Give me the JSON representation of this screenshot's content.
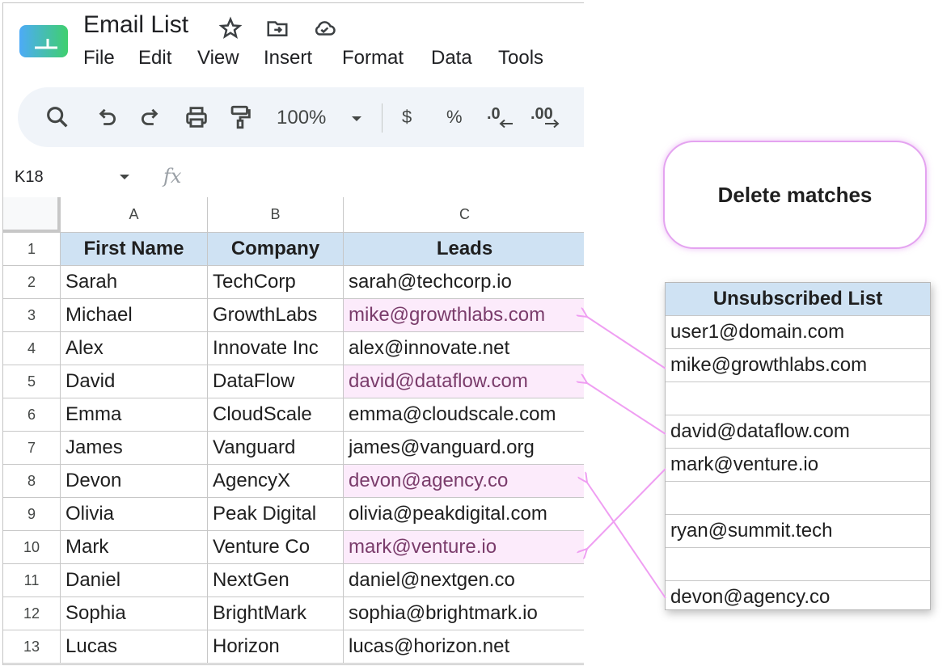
{
  "app": {
    "title": "Email List",
    "menu": [
      "File",
      "Edit",
      "View",
      "Insert",
      "Format",
      "Data",
      "Tools"
    ],
    "toolbar": {
      "zoom": "100%",
      "currency_symbol": "$",
      "percent_symbol": "%",
      "decrease_decimal": ".0",
      "increase_decimal": ".00"
    },
    "namebox": "K18",
    "fx_label": "fx"
  },
  "grid": {
    "columns": [
      "A",
      "B",
      "C"
    ],
    "row_numbers": [
      "1",
      "2",
      "3",
      "4",
      "5",
      "6",
      "7",
      "8",
      "9",
      "10",
      "11",
      "12",
      "13"
    ],
    "headers": [
      "First Name",
      "Company",
      "Leads"
    ],
    "rows": [
      {
        "first": "Sarah",
        "company": "TechCorp",
        "lead": "sarah@techcorp.io",
        "match": false
      },
      {
        "first": "Michael",
        "company": "GrowthLabs",
        "lead": "mike@growthlabs.com",
        "match": true
      },
      {
        "first": "Alex",
        "company": "Innovate Inc",
        "lead": "alex@innovate.net",
        "match": false
      },
      {
        "first": "David",
        "company": "DataFlow",
        "lead": "david@dataflow.com",
        "match": true
      },
      {
        "first": "Emma",
        "company": "CloudScale",
        "lead": "emma@cloudscale.com",
        "match": false
      },
      {
        "first": "James",
        "company": "Vanguard",
        "lead": "james@vanguard.org",
        "match": false
      },
      {
        "first": "Devon",
        "company": "AgencyX",
        "lead": "devon@agency.co",
        "match": true
      },
      {
        "first": "Olivia",
        "company": "Peak Digital",
        "lead": "olivia@peakdigital.com",
        "match": false
      },
      {
        "first": "Mark",
        "company": "Venture Co",
        "lead": "mark@venture.io",
        "match": true
      },
      {
        "first": "Daniel",
        "company": "NextGen",
        "lead": "daniel@nextgen.co",
        "match": false
      },
      {
        "first": "Sophia",
        "company": "BrightMark",
        "lead": "sophia@brightmark.io",
        "match": false
      },
      {
        "first": "Lucas",
        "company": "Horizon",
        "lead": "lucas@horizon.net",
        "match": false
      }
    ]
  },
  "unsubscribed": {
    "title": "Unsubscribed List",
    "items": [
      "user1@domain.com",
      "mike@growthlabs.com",
      "",
      "david@dataflow.com",
      "mark@venture.io",
      "",
      "ryan@summit.tech",
      "",
      "devon@agency.co"
    ]
  },
  "action_button": {
    "label": "Delete matches"
  },
  "colors": {
    "accent": "#e4a3f0",
    "match_fill": "#fcebfb",
    "header_fill": "#cfe2f3",
    "arrow": "#ef9ef2"
  },
  "icons": [
    "sheets-logo",
    "star-icon",
    "move-folder-icon",
    "cloud-saved-icon",
    "search-icon",
    "undo-icon",
    "redo-icon",
    "print-icon",
    "paint-format-icon",
    "dropdown-caret-icon"
  ]
}
